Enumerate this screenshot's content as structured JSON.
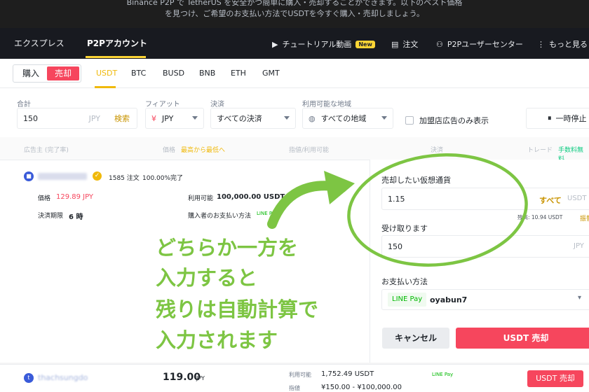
{
  "banner": {
    "line1": "Binance P2P で TetherUS を安全かつ簡単に購入・売却することができます。以下のベスト価格",
    "line2": "を見つけ、ご希望のお支払い方法でUSDTを今すぐ購入・売却しましょう。"
  },
  "topnav": {
    "tab_express": "エクスプレス",
    "tab_p2p": "P2Pアカウント",
    "tutorial": "チュートリアル動画",
    "new_badge": "New",
    "orders": "注文",
    "user_center": "P2Pユーザーセンター",
    "more": "もっと見る"
  },
  "subbar": {
    "buy": "購入",
    "sell": "売却",
    "coins": [
      "USDT",
      "BTC",
      "BUSD",
      "BNB",
      "ETH",
      "GMT"
    ]
  },
  "filters": {
    "total_label": "合計",
    "total_value": "150",
    "total_unit": "JPY",
    "search": "検索",
    "fiat_label": "フィアット",
    "fiat_symbol": "¥",
    "fiat_value": "JPY",
    "pay_label": "決済",
    "pay_value": "すべての決済",
    "region_label": "利用可能な地域",
    "region_value": "すべての地域",
    "merchant_only": "加盟店広告のみ表示",
    "pause": "一時停止"
  },
  "columns": {
    "advertiser": "広告主 (完了率)",
    "price": "価格",
    "price_sort": "最高から最低へ",
    "limit": "指値/利用可能",
    "payment": "決済",
    "trade": "トレード",
    "fee": "手数料無料"
  },
  "ad1": {
    "orders": "1585 注文",
    "completion": "100.00%完了",
    "price_label": "価格",
    "price": "129.89 JPY",
    "available_label": "利用可能",
    "available": "100,000.00 USDT",
    "deadline_label": "決済期限",
    "deadline": "6 時",
    "buyer_pay_label": "購入者のお支払い方法",
    "buyer_pay": "LINE Pay"
  },
  "panel": {
    "crypto_label": "売却したい仮想通貨",
    "crypto_value": "1.15",
    "all": "すべて",
    "crypto_unit": "USDT",
    "balance": "残高: 10.94 USDT",
    "fee_short": "振替",
    "receive_label": "受け取ります",
    "receive_value": "150",
    "receive_unit": "JPY",
    "method_label": "お支払い方法",
    "method_tag": "LINE Pay",
    "method_account": "oyabun7",
    "cancel": "キャンセル",
    "submit": "USDT 売却"
  },
  "ad2": {
    "name": "thachsungdo",
    "price": "119.00",
    "price_unit": "JPY",
    "available_label": "利用可能",
    "available": "1,752.49 USDT",
    "limit_label": "指値",
    "limit": "¥150.00 - ¥100,000.00",
    "pay": "LINE Pay",
    "button": "USDT 売却"
  },
  "annotation": {
    "line1": "どちらか一方を",
    "line2": "入力すると",
    "line3": "残りは自動計算で",
    "line4": "入力されます"
  },
  "colors": {
    "accent": "#f0b90b",
    "sell": "#f6465d",
    "annotation": "#7dc543",
    "linepay": "#00b900"
  }
}
